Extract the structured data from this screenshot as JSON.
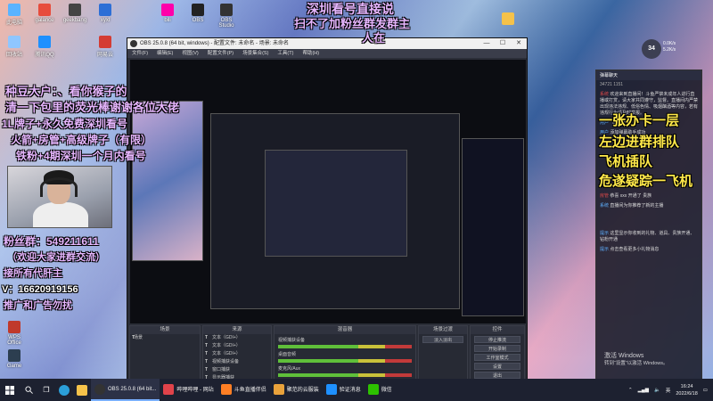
{
  "desktop": {
    "icons": [
      "此电脑",
      "galance",
      "geekbang",
      "xyxl",
      "bili",
      "OBS",
      "OBS Studio",
      "回收站",
      "腾讯QQ",
      "网易云",
      "Webcam",
      "Ai",
      "WPS Office",
      "Game",
      "NSCP"
    ]
  },
  "overlay": {
    "headline_1": "深圳看号直接说",
    "headline_2": "扫不了加粉丝群发群主",
    "headline_3": "人在",
    "left_1": "种豆大户：、看你猴子的",
    "left_2": "清一下包里的荧光棒谢谢各位大佬",
    "left_3": "1L牌子+永久免费深圳看号",
    "left_4": "火箭+房管+高级牌子（有限）",
    "left_5": "铁粉+4期深圳一个月内看号",
    "fans_group": "粉丝群：549211611",
    "welcome": "（欢迎大家进群交流）",
    "accept": "接所有代肝主",
    "wechat": "V：16620919156",
    "ad": "推广和广告勿扰",
    "right_1": "一张办卡一层",
    "right_2": "左边进群排队",
    "right_3": "飞机插队",
    "right_4": "危遂疑踪一飞机"
  },
  "obs": {
    "title": "OBS 25.0.8 (64 bit, windows) - 配置文件: 未命名 - 场景: 未命名",
    "menu": [
      "文件(F)",
      "编辑(E)",
      "视图(V)",
      "配置文件(P)",
      "场景集合(S)",
      "工具(T)",
      "帮助(H)"
    ],
    "docks": {
      "scenes": {
        "header": "场景",
        "items": [
          "场景"
        ]
      },
      "sources": {
        "header": "来源",
        "items": [
          "文本（GDI+）",
          "文本（GDI+）",
          "文本（GDI+）",
          "视频捕获设备",
          "窗口捕获",
          "显示器捕获"
        ]
      },
      "mixer": {
        "header": "混音器",
        "items": [
          "视频捕获设备",
          "桌面音频",
          "麦克风/Aux"
        ]
      },
      "transitions": {
        "header": "场景过渡",
        "label": "淡入淡出"
      },
      "controls": {
        "header": "控件",
        "buttons": [
          "停止推流",
          "开始录制",
          "工作室模式",
          "设置",
          "退出"
        ]
      }
    }
  },
  "chat": {
    "header": "弹幕聊天",
    "stats": "34721  1151",
    "lines": [
      {
        "tag": "系统",
        "text": "欢迎来到直播间！斗鱼严禁未成年人进行直播或打赏，请大家共同遵守，监督。直播间内严禁出现违法违规、低俗色情、吸烟酗酒等内容，若有违规行为请及时举报。"
      },
      {
        "tag": "用户",
        "text": "飞机插队"
      },
      {
        "tag": "用户",
        "text": "添加弹幕助手成功"
      },
      {
        "tag": "房管",
        "text": "恭喜 xxx 开通了 贵族"
      },
      {
        "tag": "系统",
        "text": "直播间为你推荐了新的主播"
      },
      {
        "tag": "提示",
        "text": "这里显示你收到的礼物、道具、贵族开通、钻粉开通"
      },
      {
        "tag": "提示",
        "text": "点击查看更多小礼物消息"
      }
    ]
  },
  "tray": {
    "badge": "34",
    "speed_up": "0.0K/s",
    "speed_down": "5.2K/s",
    "time": "16:24",
    "date": "2022/6/18",
    "lang": "英"
  },
  "windows_watermark": {
    "line1": "激活 Windows",
    "line2": "转到“设置”以激活 Windows。"
  },
  "taskbar": {
    "items": [
      {
        "label": "OBS 25.0.8 (64 bit...",
        "active": true
      },
      {
        "label": "哔哩哔哩 - 网站",
        "active": false
      },
      {
        "label": "斗鱼直播伴侣",
        "active": false
      },
      {
        "label": "聚范的云服装",
        "active": false
      },
      {
        "label": "验证消息",
        "active": false
      },
      {
        "label": "微信",
        "active": false
      }
    ]
  },
  "colors": {
    "overlay_purple": "#e7b6ff",
    "overlay_yellow": "#ffe94a",
    "obs_bg": "#2b2e38",
    "taskbar": "#1d2130"
  }
}
